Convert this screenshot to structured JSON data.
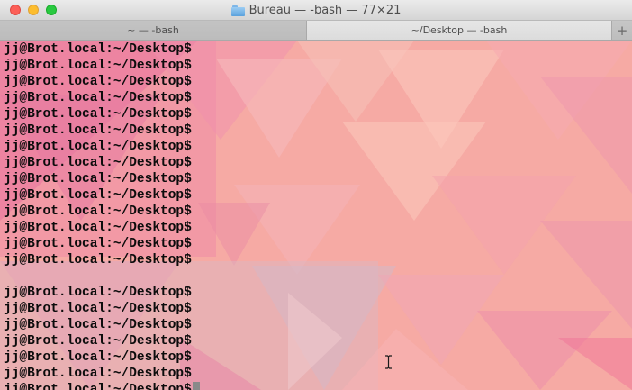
{
  "window": {
    "title": "Bureau — -bash — 77×21",
    "title_icon": "folder-icon"
  },
  "tabs": [
    {
      "label": "~ — -bash",
      "active": false
    },
    {
      "label": "~/Desktop — -bash",
      "active": true
    }
  ],
  "new_tab_label": "+",
  "terminal": {
    "prompt": "jj@Brot.local:~/Desktop$",
    "lines": [
      "jj@Brot.local:~/Desktop$",
      "jj@Brot.local:~/Desktop$",
      "jj@Brot.local:~/Desktop$",
      "jj@Brot.local:~/Desktop$",
      "jj@Brot.local:~/Desktop$",
      "jj@Brot.local:~/Desktop$",
      "jj@Brot.local:~/Desktop$",
      "jj@Brot.local:~/Desktop$",
      "jj@Brot.local:~/Desktop$",
      "jj@Brot.local:~/Desktop$",
      "jj@Brot.local:~/Desktop$",
      "jj@Brot.local:~/Desktop$",
      "jj@Brot.local:~/Desktop$",
      "jj@Brot.local:~/Desktop$",
      "",
      "jj@Brot.local:~/Desktop$",
      "jj@Brot.local:~/Desktop$",
      "jj@Brot.local:~/Desktop$",
      "jj@Brot.local:~/Desktop$",
      "jj@Brot.local:~/Desktop$",
      "jj@Brot.local:~/Desktop$",
      "jj@Brot.local:~/Desktop$"
    ],
    "colors": {
      "background": "#f5aaa5",
      "text": "#0c0c0c",
      "cursor": "#8a8a8a"
    }
  },
  "colors": {
    "close": "#fc5f57",
    "minimize": "#fdbd2e",
    "zoom": "#29c940"
  }
}
